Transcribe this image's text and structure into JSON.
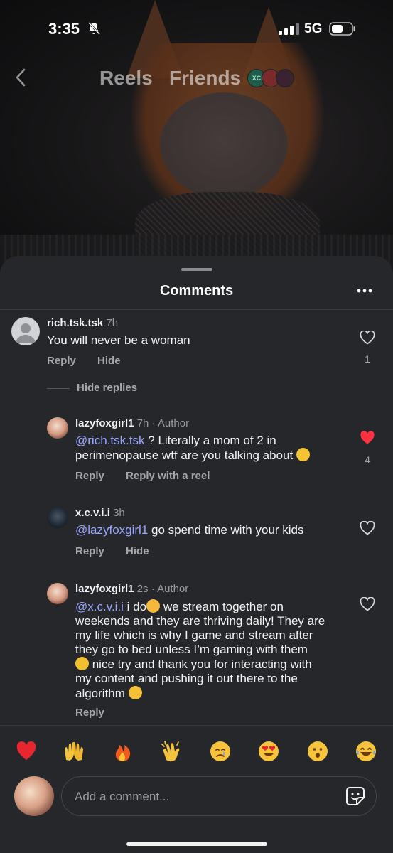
{
  "status_bar": {
    "time": "3:35",
    "network": "5G"
  },
  "nav": {
    "reels": "Reels",
    "friends": "Friends",
    "friend_avatar_label": "XC"
  },
  "sheet": {
    "title": "Comments"
  },
  "comments": [
    {
      "user": "rich.tsk.tsk",
      "time": "7h",
      "text": "You will never be a woman",
      "actions": [
        "Reply",
        "Hide"
      ],
      "likes": "1",
      "liked": false
    },
    {
      "user": "lazyfoxgirl1",
      "time": "7h",
      "tag": "Author",
      "mention": "@rich.tsk.tsk",
      "text_line1": " ? Literally a mom of 2 in",
      "text_line2": "perimenopause wtf are you talking about",
      "actions": [
        "Reply",
        "Reply with a reel"
      ],
      "likes": "4",
      "liked": true
    },
    {
      "user": "x.c.v.i.i",
      "time": "3h",
      "mention": "@lazyfoxgirl1",
      "text": " go spend time with your kids",
      "actions": [
        "Reply",
        "Hide"
      ],
      "liked": false
    },
    {
      "user": "lazyfoxgirl1",
      "time": "2s",
      "tag": "Author",
      "mention": "@x.c.v.i.i",
      "text_line1": " i do",
      "text_line1b": " we stream together on",
      "text_line2": "weekends and they are thriving daily! They are",
      "text_line3": "my life which is why I game and stream after",
      "text_line4": "they go to bed unless I’m gaming with them",
      "text_line5": " nice try and thank you for interacting with",
      "text_line6": "my content and pushing it out there to the",
      "text_line7": "algorithm",
      "actions": [
        "Reply"
      ],
      "liked": false
    }
  ],
  "hide_replies": "Hide replies",
  "author_dot": "·",
  "reactions": [
    "heart",
    "raising-hands",
    "fire",
    "clapping",
    "crying",
    "heart-eyes",
    "surprised",
    "laughing"
  ],
  "composer": {
    "placeholder": "Add a comment..."
  },
  "colors": {
    "sheet_bg": "#26272b",
    "mention": "#9aa6ff",
    "liked_heart": "#ff3040"
  }
}
